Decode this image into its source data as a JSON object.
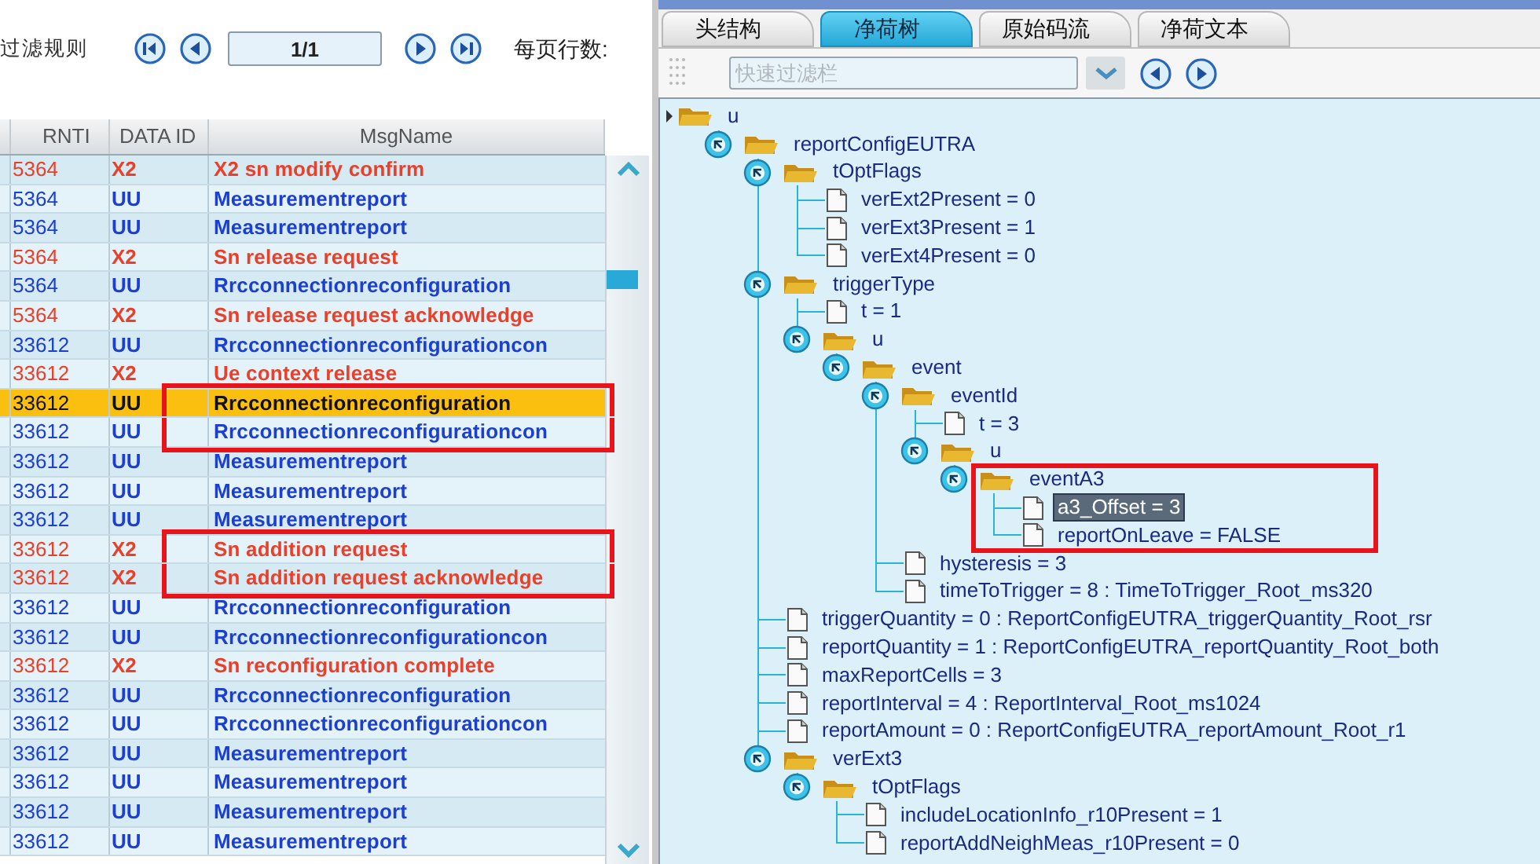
{
  "message_list": {
    "filter_label": "过滤规则",
    "page_field": "1/1",
    "rows_per_page_label": "每页行数:",
    "columns": [
      "RNTI",
      "DATA ID",
      "MsgName"
    ],
    "rows": [
      {
        "rnti": "5364",
        "data_id": "X2",
        "msg": "X2 sn modify confirm",
        "color": "#e8402a",
        "selected": false,
        "outlined": false
      },
      {
        "rnti": "5364",
        "data_id": "UU",
        "msg": "Measurementreport",
        "color": "#1c3fd0",
        "selected": false,
        "outlined": false
      },
      {
        "rnti": "5364",
        "data_id": "UU",
        "msg": "Measurementreport",
        "color": "#1c3fd0",
        "selected": false,
        "outlined": false
      },
      {
        "rnti": "5364",
        "data_id": "X2",
        "msg": "Sn release request",
        "color": "#e8402a",
        "selected": false,
        "outlined": false
      },
      {
        "rnti": "5364",
        "data_id": "UU",
        "msg": "Rrcconnectionreconfiguration",
        "color": "#1c3fd0",
        "selected": false,
        "outlined": false
      },
      {
        "rnti": "5364",
        "data_id": "X2",
        "msg": "Sn release request acknowledge",
        "color": "#e8402a",
        "selected": false,
        "outlined": false
      },
      {
        "rnti": "33612",
        "data_id": "UU",
        "msg": "Rrcconnectionreconfigurationcon",
        "color": "#1c3fd0",
        "selected": false,
        "outlined": false
      },
      {
        "rnti": "33612",
        "data_id": "X2",
        "msg": "Ue context release",
        "color": "#e8402a",
        "selected": false,
        "outlined": false
      },
      {
        "rnti": "33612",
        "data_id": "UU",
        "msg": "Rrcconnectionreconfiguration",
        "selected": true,
        "outlined": true
      },
      {
        "rnti": "33612",
        "data_id": "UU",
        "msg": "Rrcconnectionreconfigurationcon",
        "color": "#1c3fd0",
        "selected": false,
        "outlined": true
      },
      {
        "rnti": "33612",
        "data_id": "UU",
        "msg": "Measurementreport",
        "color": "#1c3fd0",
        "selected": false,
        "outlined": false
      },
      {
        "rnti": "33612",
        "data_id": "UU",
        "msg": "Measurementreport",
        "color": "#1c3fd0",
        "selected": false,
        "outlined": false
      },
      {
        "rnti": "33612",
        "data_id": "UU",
        "msg": "Measurementreport",
        "color": "#1c3fd0",
        "selected": false,
        "outlined": false
      },
      {
        "rnti": "33612",
        "data_id": "X2",
        "msg": "Sn addition request",
        "color": "#e8402a",
        "selected": false,
        "outlined": true
      },
      {
        "rnti": "33612",
        "data_id": "X2",
        "msg": "Sn addition request acknowledge",
        "color": "#e8402a",
        "selected": false,
        "outlined": true
      },
      {
        "rnti": "33612",
        "data_id": "UU",
        "msg": "Rrcconnectionreconfiguration",
        "color": "#1c3fd0",
        "selected": false,
        "outlined": false
      },
      {
        "rnti": "33612",
        "data_id": "UU",
        "msg": "Rrcconnectionreconfigurationcon",
        "color": "#1c3fd0",
        "selected": false,
        "outlined": false
      },
      {
        "rnti": "33612",
        "data_id": "X2",
        "msg": "Sn reconfiguration complete",
        "color": "#e8402a",
        "selected": false,
        "outlined": false
      },
      {
        "rnti": "33612",
        "data_id": "UU",
        "msg": "Rrcconnectionreconfiguration",
        "color": "#1c3fd0",
        "selected": false,
        "outlined": false
      },
      {
        "rnti": "33612",
        "data_id": "UU",
        "msg": "Rrcconnectionreconfigurationcon",
        "color": "#1c3fd0",
        "selected": false,
        "outlined": false
      },
      {
        "rnti": "33612",
        "data_id": "UU",
        "msg": "Measurementreport",
        "color": "#1c3fd0",
        "selected": false,
        "outlined": false
      },
      {
        "rnti": "33612",
        "data_id": "UU",
        "msg": "Measurementreport",
        "color": "#1c3fd0",
        "selected": false,
        "outlined": false
      },
      {
        "rnti": "33612",
        "data_id": "UU",
        "msg": "Measurementreport",
        "color": "#1c3fd0",
        "selected": false,
        "outlined": false
      },
      {
        "rnti": "33612",
        "data_id": "UU",
        "msg": "Measurementreport",
        "color": "#1c3fd0",
        "selected": false,
        "outlined": false
      }
    ]
  },
  "detail": {
    "tabs": [
      {
        "label": "头结构",
        "selected": false
      },
      {
        "label": "净荷树",
        "selected": true
      },
      {
        "label": "原始码流",
        "selected": false
      },
      {
        "label": "净荷文本",
        "selected": false
      }
    ],
    "filter": {
      "placeholder": "快速过滤栏"
    },
    "tree": {
      "label": "u",
      "kind": "root",
      "selected": false,
      "outlined": false,
      "children": [
        {
          "label": "reportConfigEUTRA",
          "kind": "folder",
          "expanded": true,
          "selected": false,
          "outlined": false,
          "children": [
            {
              "label": "tOptFlags",
              "kind": "folder",
              "expanded": true,
              "selected": false,
              "outlined": false,
              "children": [
                {
                  "label": "verExt2Present = 0",
                  "kind": "leaf",
                  "selected": false,
                  "outlined": false
                },
                {
                  "label": "verExt3Present = 1",
                  "kind": "leaf",
                  "selected": false,
                  "outlined": false
                },
                {
                  "label": "verExt4Present = 0",
                  "kind": "leaf",
                  "selected": false,
                  "outlined": false
                }
              ]
            },
            {
              "label": "triggerType",
              "kind": "folder",
              "expanded": true,
              "selected": false,
              "outlined": false,
              "children": [
                {
                  "label": "t = 1",
                  "kind": "leaf",
                  "selected": false,
                  "outlined": false
                },
                {
                  "label": "u",
                  "kind": "folder",
                  "expanded": true,
                  "selected": false,
                  "outlined": false,
                  "children": [
                    {
                      "label": "event",
                      "kind": "folder",
                      "expanded": true,
                      "selected": false,
                      "outlined": false,
                      "children": [
                        {
                          "label": "eventId",
                          "kind": "folder",
                          "expanded": true,
                          "selected": false,
                          "outlined": false,
                          "children": [
                            {
                              "label": "t = 3",
                              "kind": "leaf",
                              "selected": false,
                              "outlined": false
                            },
                            {
                              "label": "u",
                              "kind": "folder",
                              "expanded": true,
                              "selected": false,
                              "outlined": false,
                              "children": [
                                {
                                  "label": "eventA3",
                                  "kind": "folder",
                                  "expanded": true,
                                  "selected": false,
                                  "outlined": true,
                                  "children": [
                                    {
                                      "label": "a3_Offset = 3",
                                      "kind": "leaf",
                                      "selected": true,
                                      "outlined": false
                                    },
                                    {
                                      "label": "reportOnLeave = FALSE",
                                      "kind": "leaf",
                                      "selected": false,
                                      "outlined": false
                                    }
                                  ]
                                }
                              ]
                            }
                          ]
                        },
                        {
                          "label": "hysteresis = 3",
                          "kind": "leaf",
                          "selected": false,
                          "outlined": false
                        },
                        {
                          "label": "timeToTrigger = 8 : TimeToTrigger_Root_ms320",
                          "kind": "leaf",
                          "selected": false,
                          "outlined": false
                        }
                      ]
                    }
                  ]
                }
              ]
            },
            {
              "label": "triggerQuantity = 0 : ReportConfigEUTRA_triggerQuantity_Root_rsr",
              "kind": "leaf",
              "selected": false,
              "outlined": false
            },
            {
              "label": "reportQuantity = 1 : ReportConfigEUTRA_reportQuantity_Root_both",
              "kind": "leaf",
              "selected": false,
              "outlined": false
            },
            {
              "label": "maxReportCells = 3",
              "kind": "leaf",
              "selected": false,
              "outlined": false
            },
            {
              "label": "reportInterval = 4 : ReportInterval_Root_ms1024",
              "kind": "leaf",
              "selected": false,
              "outlined": false
            },
            {
              "label": "reportAmount = 0 : ReportConfigEUTRA_reportAmount_Root_r1",
              "kind": "leaf",
              "selected": false,
              "outlined": false
            },
            {
              "label": "verExt3",
              "kind": "folder",
              "expanded": true,
              "selected": false,
              "outlined": false,
              "children": [
                {
                  "label": "tOptFlags",
                  "kind": "folder",
                  "expanded": true,
                  "selected": false,
                  "outlined": false,
                  "children": [
                    {
                      "label": "includeLocationInfo_r10Present = 1",
                      "kind": "leaf",
                      "selected": false,
                      "outlined": false
                    },
                    {
                      "label": "reportAddNeighMeas_r10Present = 0",
                      "kind": "leaf",
                      "selected": false,
                      "outlined": false
                    }
                  ]
                }
              ]
            }
          ]
        }
      ]
    }
  }
}
